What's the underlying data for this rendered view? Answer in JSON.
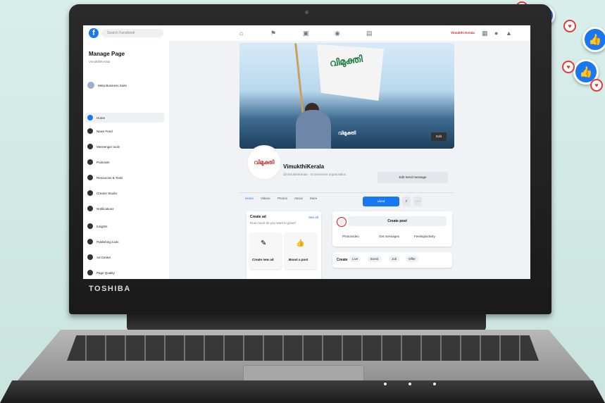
{
  "colors": {
    "facebook_blue": "#1877f2",
    "background": "#d3ebe6",
    "laptop": "#1f1f1f"
  },
  "laptop": {
    "brand": "TOSHIBA"
  },
  "facebook": {
    "search_placeholder": "Search Facebook",
    "topbar_user": "Vimukthi Kerala",
    "sidebar": {
      "title": "Manage Page",
      "subtitle": "VimukthiKerala",
      "account": "Meta Business Suite",
      "items": [
        {
          "label": "Home",
          "icon": "home-icon"
        },
        {
          "label": "News Feed",
          "icon": "newsfeed-icon"
        },
        {
          "label": "Messenger tools",
          "icon": "messenger-icon"
        },
        {
          "label": "Podcasts",
          "icon": "podcast-icon"
        },
        {
          "label": "Resources & Tools",
          "icon": "resources-icon"
        },
        {
          "label": "Creator Studio",
          "icon": "studio-icon"
        },
        {
          "label": "Notifications",
          "icon": "bell-icon"
        },
        {
          "label": "Insights",
          "icon": "insights-icon"
        },
        {
          "label": "Publishing tools",
          "icon": "publishing-icon"
        },
        {
          "label": "Ad Center",
          "icon": "ad-icon"
        },
        {
          "label": "Page Quality",
          "icon": "quality-icon"
        }
      ]
    },
    "page": {
      "name": "VimukthiKerala",
      "subtitle": "@VimukthiKerala · Government organization",
      "cover_label": "വിമുക്തി",
      "edit_cover": "Edit",
      "send_message": "Edit Send message",
      "like_button": "Liked",
      "tabs": [
        "Home",
        "Videos",
        "Photos",
        "About",
        "More"
      ]
    },
    "create_ad": {
      "title": "Create ad",
      "description": "How much do you want to grow?",
      "see_all": "See all",
      "options": [
        "Create new ad",
        "Boost a post"
      ]
    },
    "create_post": {
      "button": "Create post",
      "actions": [
        "Photo/video",
        "Get messages",
        "Feeling/activity"
      ],
      "create_label": "Create",
      "chips": [
        "Live",
        "Event",
        "Job",
        "Offer"
      ]
    }
  }
}
